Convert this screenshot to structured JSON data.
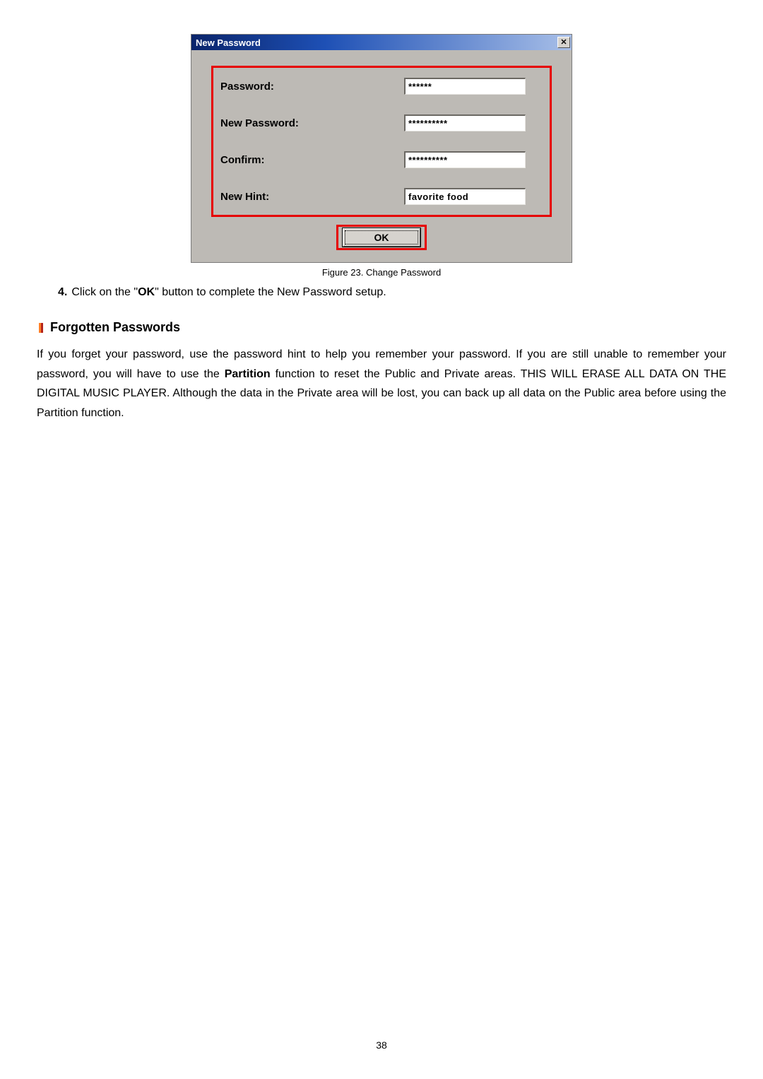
{
  "dialog": {
    "title": "New Password",
    "close_glyph": "✕",
    "fields": {
      "password_label": "Password:",
      "password_value": "******",
      "newpass_label": "New Password:",
      "newpass_value": "**********",
      "confirm_label": "Confirm:",
      "confirm_value": "**********",
      "hint_label": "New Hint:",
      "hint_value": "favorite food"
    },
    "ok_label": "OK"
  },
  "caption": "Figure 23. Change Password",
  "step": {
    "num": "4.",
    "pre": "Click on the \"",
    "bold": "OK",
    "post": "\" button to complete the New Password setup."
  },
  "section_title": "Forgotten Passwords",
  "body": {
    "p1a": "If you forget your password, use the password hint to help you remember your password. If you are still unable to remember your password, you will have to use the ",
    "p1bold": "Partition",
    "p1b": " function to reset the Public and Private areas. THIS WILL ERASE ALL DATA ON THE DIGITAL MUSIC PLAYER. Although the data in the Private area will be lost, you can back up all data on the Public area before using the Partition function."
  },
  "page_number": "38"
}
